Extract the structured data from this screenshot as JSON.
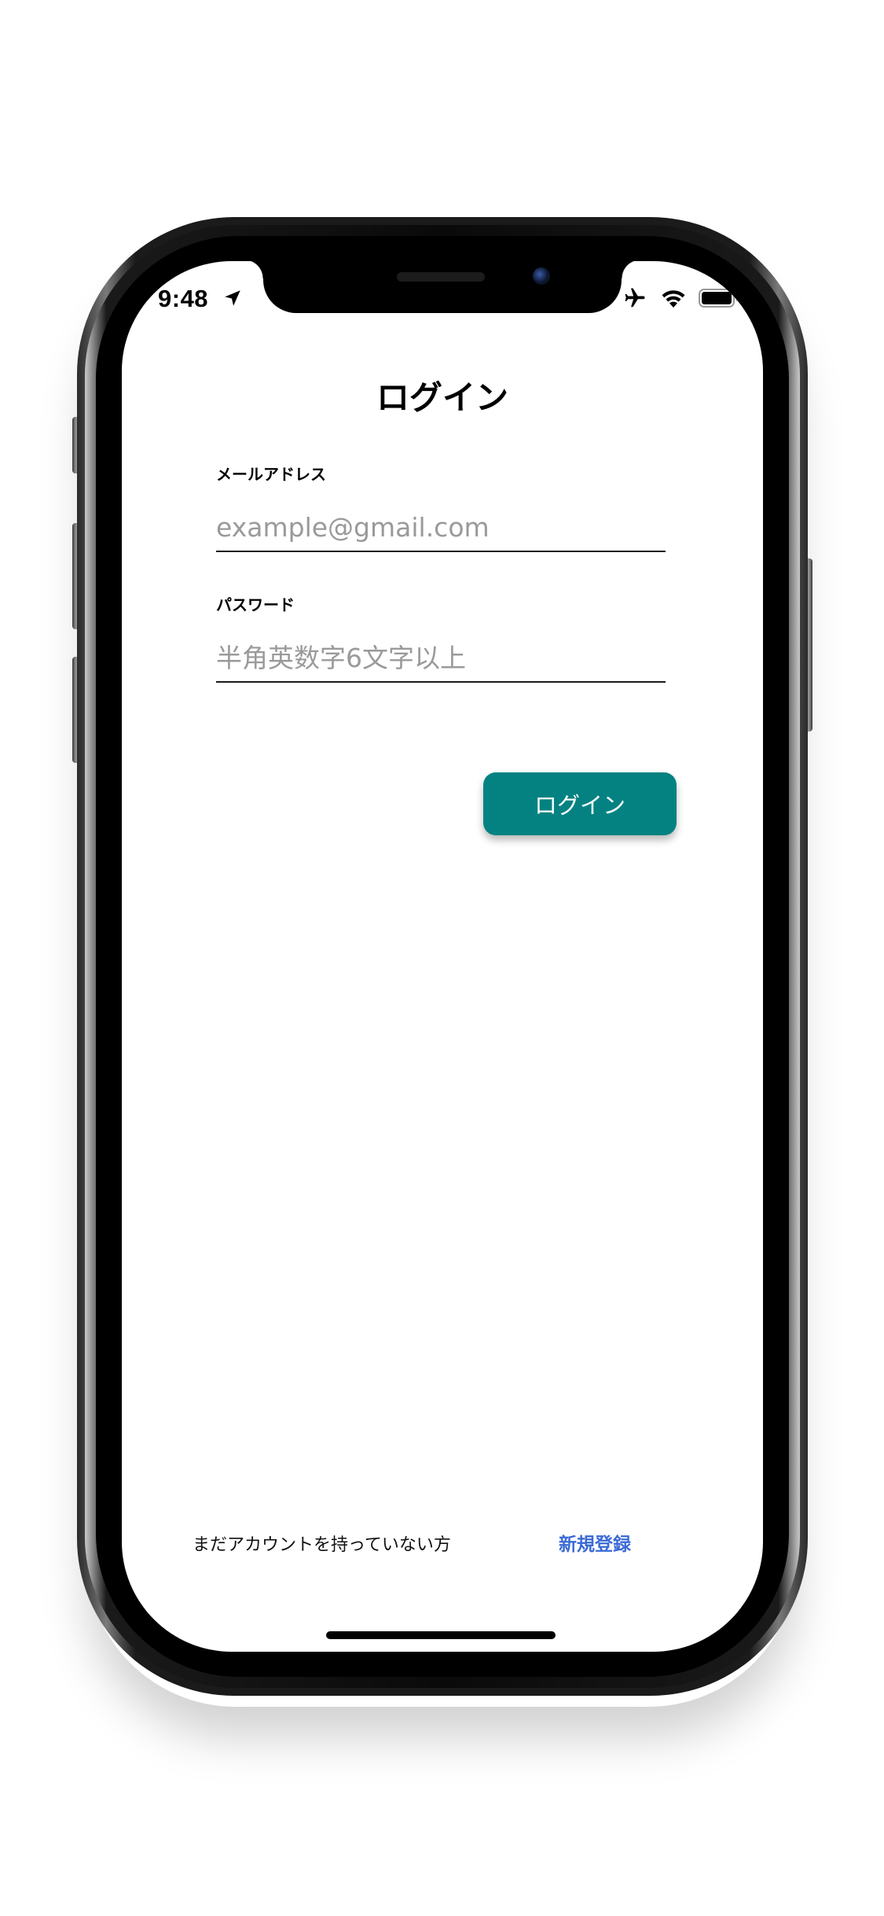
{
  "status_bar": {
    "time": "9:48",
    "icons": [
      "location-arrow-icon",
      "airplane-icon",
      "wifi-icon",
      "battery-icon"
    ]
  },
  "screen": {
    "title": "ログイン",
    "email": {
      "label": "メールアドレス",
      "placeholder": "example@gmail.com",
      "value": ""
    },
    "password": {
      "label": "パスワード",
      "placeholder": "半角英数字6文字以上",
      "value": ""
    },
    "login_button_label": "ログイン",
    "footer": {
      "prompt": "まだアカウントを持っていない方",
      "signup_link": "新規登録"
    }
  },
  "colors": {
    "primary_button": "#048282",
    "link": "#3a6ad6",
    "text": "#000000",
    "placeholder": "#9a9a9a"
  }
}
